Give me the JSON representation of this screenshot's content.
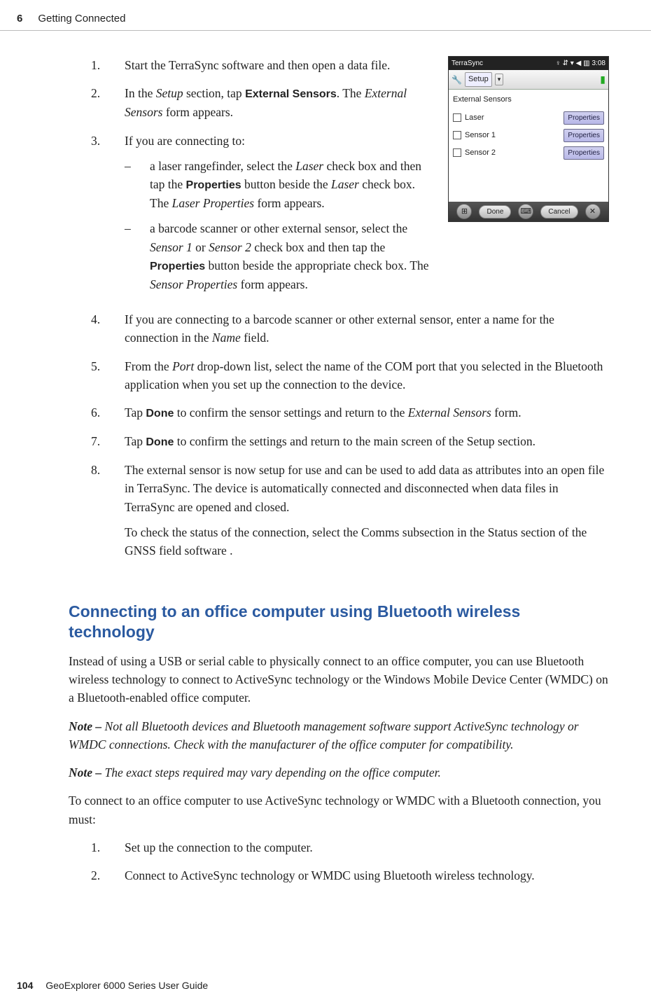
{
  "header": {
    "chapter_num": "6",
    "chapter_title": "Getting Connected"
  },
  "steps": {
    "s1": "Start the TerraSync software and then open a data file.",
    "s2_a": "In the ",
    "s2_b": "Setup",
    "s2_c": " section, tap ",
    "s2_d": "External Sensors",
    "s2_e": ". The ",
    "s2_f": "External Sensors",
    "s2_g": " form appears.",
    "s3": "If you are connecting to:",
    "s3a_a": "a laser rangefinder, select the ",
    "s3a_b": "Laser",
    "s3a_c": " check box and then tap the ",
    "s3a_d": "Properties",
    "s3a_e": " button beside the ",
    "s3a_f": "Laser",
    "s3a_g": " check box. The ",
    "s3a_h": "Laser Properties",
    "s3a_i": " form appears.",
    "s3b_a": "a barcode scanner or other external sensor, select the ",
    "s3b_b": "Sensor 1",
    "s3b_c": " or ",
    "s3b_d": "Sensor 2",
    "s3b_e": " check box and then tap the ",
    "s3b_f": "Properties",
    "s3b_g": " button beside the appropriate check box. The ",
    "s3b_h": "Sensor Properties",
    "s3b_i": " form appears.",
    "s4_a": "If you are connecting to a barcode scanner or other external sensor, enter a name for the connection in the ",
    "s4_b": "Name",
    "s4_c": " field.",
    "s5_a": "From the ",
    "s5_b": "Port",
    "s5_c": " drop-down list, select the name of the COM port that you selected in the Bluetooth application when you set up the connection to the  device.",
    "s6_a": "Tap ",
    "s6_b": "Done",
    "s6_c": " to confirm the sensor settings and return to the ",
    "s6_d": "External Sensors",
    "s6_e": " form.",
    "s7_a": "Tap ",
    "s7_b": "Done",
    "s7_c": " to confirm the settings and return to the main screen of the Setup section.",
    "s8_a": "The external sensor is now setup for use and can be used to add data as attributes into an open file in TerraSync. The device is automatically connected and disconnected when data files in TerraSync are opened and closed.",
    "s8_b": "To check the status of the connection, select the Comms subsection in the Status section of the GNSS field software ."
  },
  "section_heading": "Connecting to an office computer using Bluetooth wireless technology",
  "section_body": {
    "p1": "Instead of using a USB or serial cable to physically connect to an office computer, you can use Bluetooth wireless technology to connect to ActiveSync technology or the Windows Mobile Device Center (WMDC) on a Bluetooth-enabled office computer.",
    "note1_lead": "Note – ",
    "note1": "Not all Bluetooth devices and Bluetooth management software support ActiveSync technology or WMDC connections. Check with the manufacturer of the office computer for compatibility.",
    "note2_lead": "Note – ",
    "note2": "The exact steps required may vary depending on the office computer.",
    "p2": "To connect to an office computer to use ActiveSync technology or WMDC with a Bluetooth connection, you must:",
    "ol1": "Set up the connection to the computer.",
    "ol2": "Connect to ActiveSync technology or WMDC using Bluetooth wireless technology."
  },
  "screenshot": {
    "app": "TerraSync",
    "time": "3:08",
    "menu_setup": "Setup",
    "form_title": "External Sensors",
    "row_laser": "Laser",
    "row_s1": "Sensor 1",
    "row_s2": "Sensor 2",
    "properties": "Properties",
    "done": "Done",
    "cancel": "Cancel"
  },
  "footer": {
    "page": "104",
    "book": "GeoExplorer 6000 Series User Guide"
  }
}
